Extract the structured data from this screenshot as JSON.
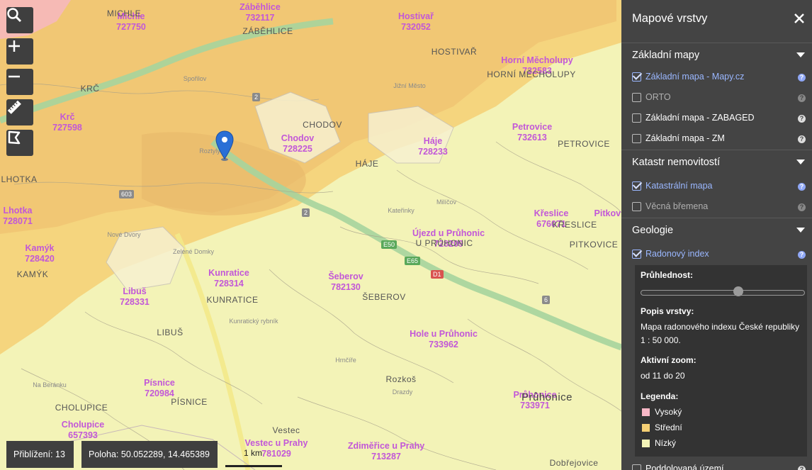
{
  "map": {
    "cadastral_labels": [
      {
        "name": "Michle",
        "code": "727750"
      },
      {
        "name": "Záběhlice",
        "code": "732117"
      },
      {
        "name": "Hostivař",
        "code": "732052"
      },
      {
        "name": "Horní Měcholupy",
        "code": "732583"
      },
      {
        "name": "Krč",
        "code": "727598"
      },
      {
        "name": "Chodov",
        "code": "728225"
      },
      {
        "name": "Háje",
        "code": "728233"
      },
      {
        "name": "Petrovice",
        "code": "732613"
      },
      {
        "name": "Lhotka",
        "code": "728071"
      },
      {
        "name": "Kamýk",
        "code": "728420"
      },
      {
        "name": "Újezd u Průhonic",
        "code": "728209"
      },
      {
        "name": "Křeslice",
        "code": "676071"
      },
      {
        "name": "Kunratice",
        "code": "728314"
      },
      {
        "name": "Šeberov",
        "code": "782130"
      },
      {
        "name": "Libuš",
        "code": "728331"
      },
      {
        "name": "Hole u Průhonic",
        "code": "733962"
      },
      {
        "name": "Písnice",
        "code": "720984"
      },
      {
        "name": "Průhonice",
        "code": "733971"
      },
      {
        "name": "Cholupice",
        "code": "657393"
      },
      {
        "name": "Vestec u Prahy",
        "code": "781029"
      },
      {
        "name": "Zdiměřice u Prahy",
        "code": "713287"
      },
      {
        "name": "Pitkovice",
        "code": ""
      }
    ],
    "place_labels": [
      "MICHLE",
      "ZÁBĚHLICE",
      "HOSTIVAŘ",
      "HORNÍ MĚCHOLUPY",
      "KRČ",
      "CHODOV",
      "HÁJE",
      "PETROVICE",
      "LHOTKA",
      "KAMÝK",
      "U PRŮHONIC",
      "KŘESLICE",
      "PITKOVICE",
      "KUNRATICE",
      "ŠEBEROV",
      "LIBUŠ",
      "PÍSNICE",
      "CHOLUPICE",
      "Průhonice",
      "Vestec",
      "Dobřejovice",
      "Rozkoš"
    ],
    "small_labels": [
      "Spořilov",
      "Roztyly",
      "Jižní Město",
      "Milíčov",
      "Kateřinky",
      "Nové Dvory",
      "Zelené Domky",
      "Kunratický rybník",
      "Hrnčíře",
      "Drazdy",
      "Na Beránku"
    ],
    "road_labels": [
      "603",
      "E50",
      "E65",
      "D1",
      "2",
      "2",
      "6"
    ],
    "marker_icon": "location-pin-icon",
    "colors": {
      "high": "#f7b7c6",
      "medium": "#f5cf74",
      "low": "#f3f3b7",
      "road": "#a6d49d"
    }
  },
  "controls": {
    "search": "search-icon",
    "zoom_in": "plus-icon",
    "zoom_out": "minus-icon",
    "measure": "ruler-icon",
    "draw": "polygon-icon"
  },
  "status": {
    "zoom": "Přiblížení: 13",
    "position": "Poloha: 50.052289, 14.465389",
    "scale": "1 km"
  },
  "panel": {
    "title": "Mapové vrstvy",
    "sections": [
      {
        "title": "Základní mapy",
        "layers": [
          {
            "label": "Základní mapa - Mapy.cz",
            "checked": true
          },
          {
            "label": "ORTO",
            "checked": false,
            "disabled": true
          },
          {
            "label": "Základní mapa - ZABAGED",
            "checked": false
          },
          {
            "label": "Základní mapa - ZM",
            "checked": false
          }
        ]
      },
      {
        "title": "Katastr nemovitostí",
        "layers": [
          {
            "label": "Katastrální mapa",
            "checked": true
          },
          {
            "label": "Věcná břemena",
            "checked": false,
            "disabled": true
          }
        ]
      },
      {
        "title": "Geologie",
        "layers": [
          {
            "label": "Radonový index",
            "checked": true
          },
          {
            "label": "Poddolovaná území",
            "checked": false
          }
        ]
      }
    ],
    "detail": {
      "opacity_label": "Průhlednost:",
      "opacity_value": 0.6,
      "desc_label": "Popis vrstvy:",
      "desc": "Mapa radonového indexu České republiky 1 : 50 000.",
      "zoom_label": "Aktivní zoom:",
      "zoom": "od 11 do 20",
      "legend_label": "Legenda:",
      "legend": [
        {
          "label": "Vysoký",
          "color": "#f7b7c6"
        },
        {
          "label": "Střední",
          "color": "#f5cf74"
        },
        {
          "label": "Nízký",
          "color": "#f3f3b7"
        }
      ]
    }
  }
}
